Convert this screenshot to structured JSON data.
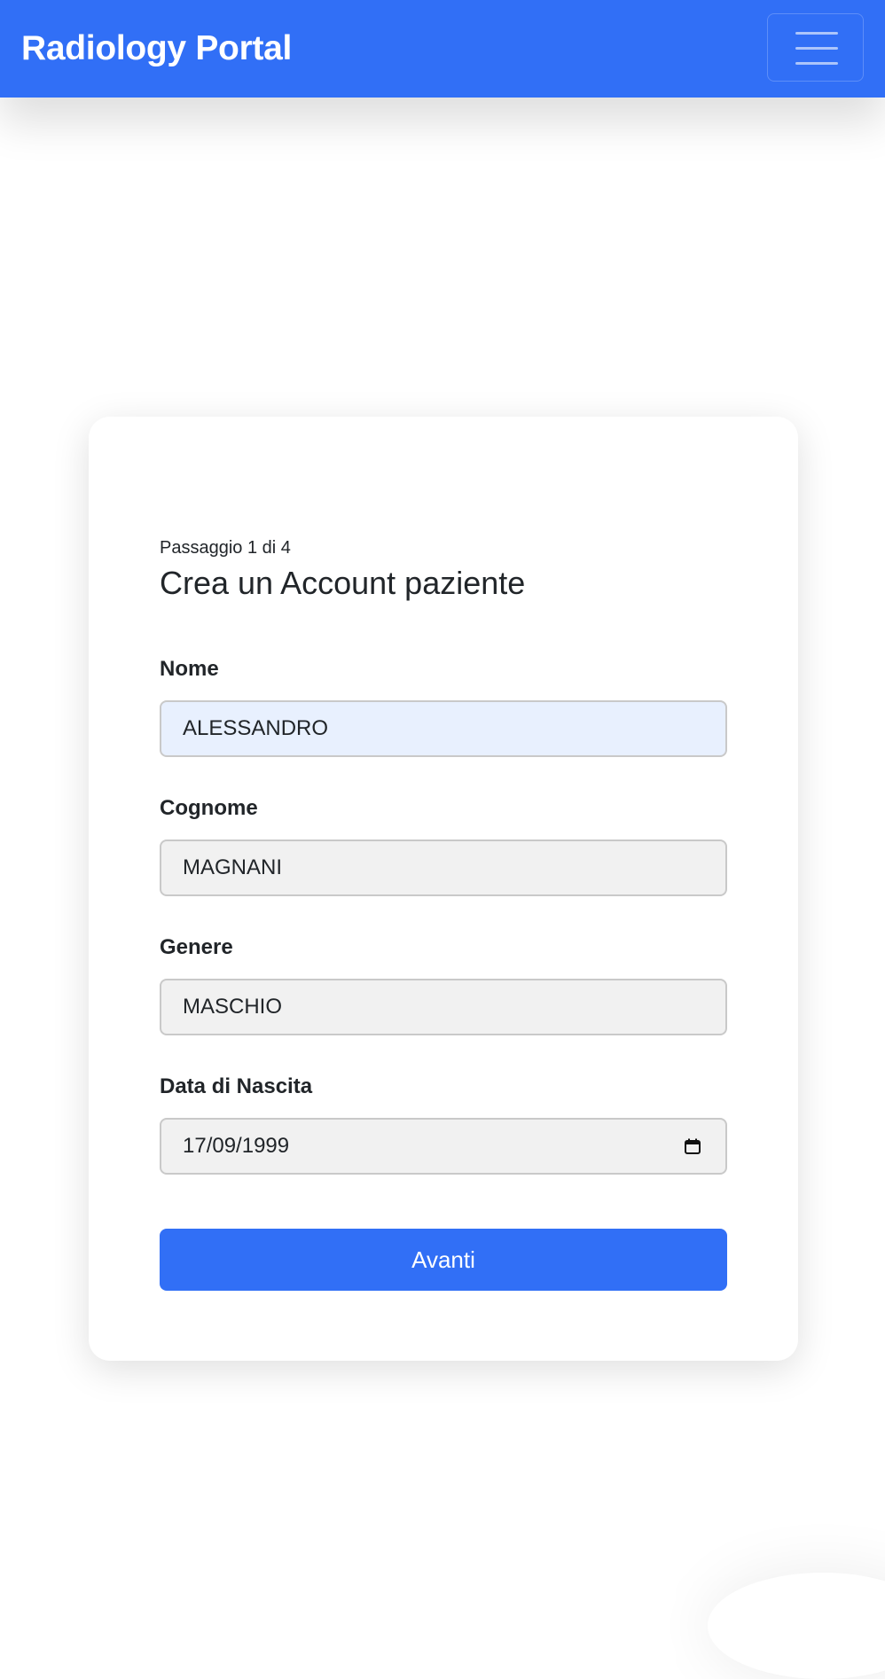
{
  "navbar": {
    "brand": "Radiology Portal",
    "menu_icon": "hamburger-menu-icon"
  },
  "form": {
    "step": "Passaggio 1 di 4",
    "title": "Crea un Account paziente",
    "fields": {
      "nome": {
        "label": "Nome",
        "value": "ALESSANDRO"
      },
      "cognome": {
        "label": "Cognome",
        "value": "MAGNANI"
      },
      "genere": {
        "label": "Genere",
        "value": "MASCHIO"
      },
      "data_nascita": {
        "label": "Data di Nascita",
        "value": "17/09/1999",
        "icon": "calendar-icon"
      }
    },
    "submit_label": "Avanti"
  },
  "colors": {
    "primary": "#316ff6",
    "autofill_background": "#e8f0fe",
    "input_background": "#f1f1f1"
  }
}
